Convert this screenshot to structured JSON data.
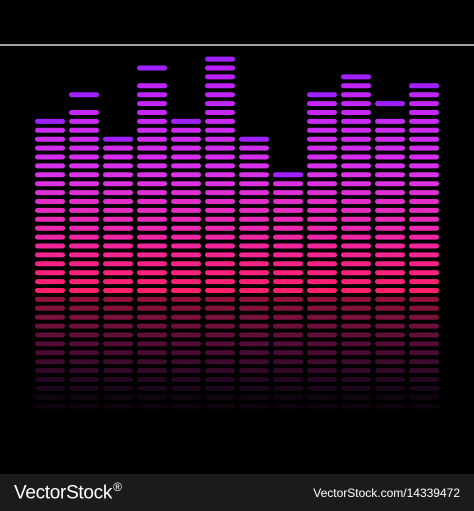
{
  "equalizer": {
    "column_peak_levels": [
      20,
      23,
      18,
      26,
      20,
      27,
      18,
      14,
      23,
      25,
      22,
      24
    ],
    "column_bar_levels": [
      19,
      21,
      17,
      24,
      19,
      26,
      17,
      13,
      22,
      24,
      20,
      23
    ],
    "base_level_count": 13,
    "colors": {
      "top": "#b61fff",
      "middle": "#d832e8",
      "bottom": "#ff1f6a",
      "peak": "#a020ff"
    }
  },
  "footer": {
    "brand": "VectorStock",
    "brand_mark": "®",
    "image_id": "VectorStock.com/14339472"
  }
}
